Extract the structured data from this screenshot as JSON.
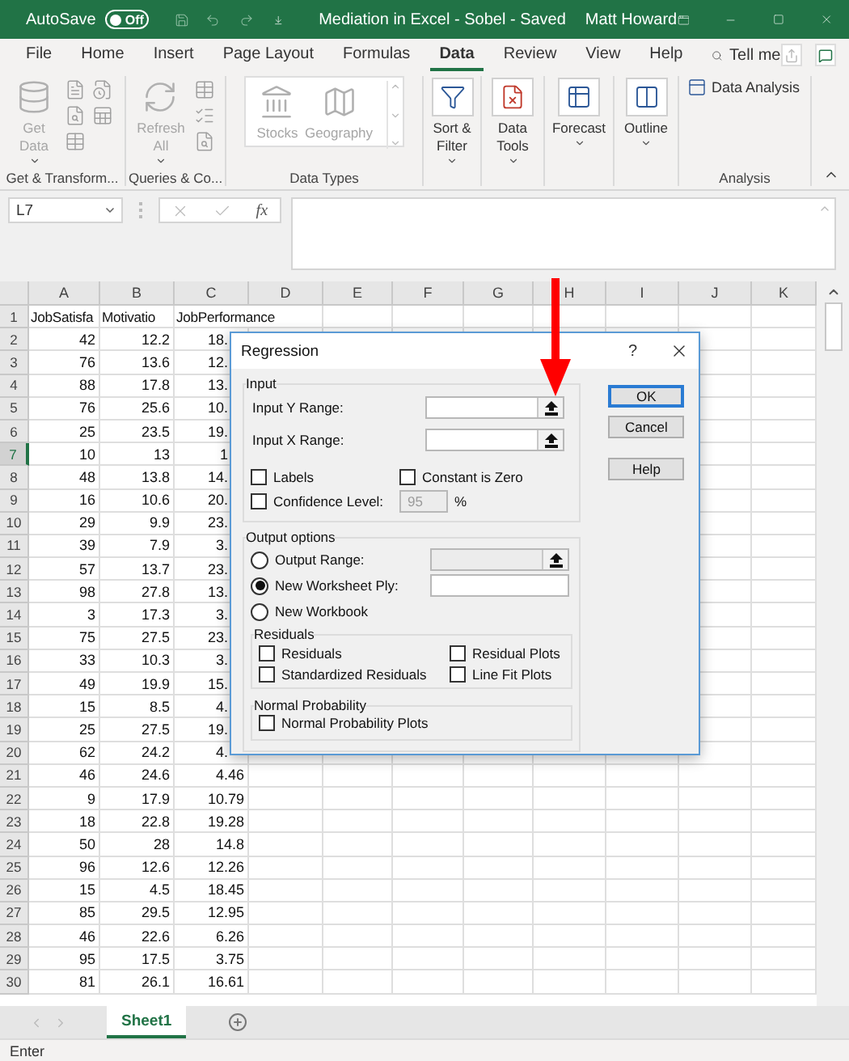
{
  "title_bar": {
    "autosave_label": "AutoSave",
    "autosave_toggle": {
      "text": "Off",
      "on": false
    },
    "title": "Mediation in Excel - Sobel  -  Saved",
    "user": "Matt Howard"
  },
  "menu_tabs": [
    {
      "label": "File",
      "selected": false
    },
    {
      "label": "Home",
      "selected": false
    },
    {
      "label": "Insert",
      "selected": false
    },
    {
      "label": "Page Layout",
      "selected": false
    },
    {
      "label": "Formulas",
      "selected": false
    },
    {
      "label": "Data",
      "selected": true
    },
    {
      "label": "Review",
      "selected": false
    },
    {
      "label": "View",
      "selected": false
    },
    {
      "label": "Help",
      "selected": false
    }
  ],
  "tell_me": "Tell me",
  "ribbon": {
    "groups": [
      {
        "kind": "get",
        "label": "Get & Transform...",
        "buttons": [
          {
            "lines": [
              "Get",
              "Data"
            ],
            "dropdown": true,
            "disabled": true
          }
        ]
      },
      {
        "kind": "queries",
        "label": "Queries & Co...",
        "buttons": [
          {
            "lines": [
              "Refresh",
              "All"
            ],
            "dropdown": true,
            "disabled": true
          }
        ]
      },
      {
        "kind": "gallery",
        "label": "Data Types",
        "buttons": [
          {
            "lines": [
              "Stocks"
            ],
            "dropdown": false,
            "disabled": true
          },
          {
            "lines": [
              "Geography"
            ],
            "dropdown": false,
            "disabled": true
          }
        ]
      },
      {
        "kind": "big",
        "buttons": [
          {
            "lines": [
              "Sort &",
              "Filter"
            ],
            "dropdown": true,
            "disabled": false
          }
        ]
      },
      {
        "kind": "big",
        "buttons": [
          {
            "lines": [
              "Data",
              "Tools"
            ],
            "dropdown": true,
            "disabled": false
          }
        ]
      },
      {
        "kind": "big",
        "buttons": [
          {
            "lines": [
              "Forecast"
            ],
            "dropdown": true,
            "disabled": false
          }
        ]
      },
      {
        "kind": "big",
        "buttons": [
          {
            "lines": [
              "Outline"
            ],
            "dropdown": true,
            "disabled": false
          }
        ]
      },
      {
        "kind": "analysis",
        "label": "Analysis",
        "buttons": [
          {
            "lines": [
              "Data Analysis"
            ],
            "dropdown": false,
            "disabled": false
          }
        ]
      }
    ]
  },
  "formula_bar": {
    "name_box": "L7",
    "function_button": "fx"
  },
  "columns": [
    "A",
    "B",
    "C",
    "D",
    "E",
    "F",
    "G",
    "H",
    "I",
    "J",
    "K"
  ],
  "rows": [
    {
      "number": "1",
      "kind": "text",
      "selected": false,
      "cells": [
        "JobSatisfa",
        "Motivatio",
        "JobPerformance"
      ]
    },
    {
      "number": "2",
      "kind": "number",
      "selected": false,
      "covered": true,
      "cells": [
        "42",
        "12.2",
        "18."
      ]
    },
    {
      "number": "3",
      "kind": "number",
      "selected": false,
      "covered": true,
      "cells": [
        "76",
        "13.6",
        "12."
      ]
    },
    {
      "number": "4",
      "kind": "number",
      "selected": false,
      "covered": true,
      "cells": [
        "88",
        "17.8",
        "13."
      ]
    },
    {
      "number": "5",
      "kind": "number",
      "selected": false,
      "covered": true,
      "cells": [
        "76",
        "25.6",
        "10."
      ]
    },
    {
      "number": "6",
      "kind": "number",
      "selected": false,
      "covered": true,
      "cells": [
        "25",
        "23.5",
        "19."
      ]
    },
    {
      "number": "7",
      "kind": "number",
      "selected": true,
      "covered": true,
      "cells": [
        "10",
        "13",
        "1"
      ]
    },
    {
      "number": "8",
      "kind": "number",
      "selected": false,
      "covered": true,
      "cells": [
        "48",
        "13.8",
        "14."
      ]
    },
    {
      "number": "9",
      "kind": "number",
      "selected": false,
      "covered": true,
      "cells": [
        "16",
        "10.6",
        "20."
      ]
    },
    {
      "number": "10",
      "kind": "number",
      "selected": false,
      "covered": true,
      "cells": [
        "29",
        "9.9",
        "23."
      ]
    },
    {
      "number": "11",
      "kind": "number",
      "selected": false,
      "covered": true,
      "cells": [
        "39",
        "7.9",
        "3."
      ]
    },
    {
      "number": "12",
      "kind": "number",
      "selected": false,
      "covered": true,
      "cells": [
        "57",
        "13.7",
        "23."
      ]
    },
    {
      "number": "13",
      "kind": "number",
      "selected": false,
      "covered": true,
      "cells": [
        "98",
        "27.8",
        "13."
      ]
    },
    {
      "number": "14",
      "kind": "number",
      "selected": false,
      "covered": true,
      "cells": [
        "3",
        "17.3",
        "3."
      ]
    },
    {
      "number": "15",
      "kind": "number",
      "selected": false,
      "covered": true,
      "cells": [
        "75",
        "27.5",
        "23."
      ]
    },
    {
      "number": "16",
      "kind": "number",
      "selected": false,
      "covered": true,
      "cells": [
        "33",
        "10.3",
        "3."
      ]
    },
    {
      "number": "17",
      "kind": "number",
      "selected": false,
      "covered": true,
      "cells": [
        "49",
        "19.9",
        "15."
      ]
    },
    {
      "number": "18",
      "kind": "number",
      "selected": false,
      "covered": true,
      "cells": [
        "15",
        "8.5",
        "4."
      ]
    },
    {
      "number": "19",
      "kind": "number",
      "selected": false,
      "covered": true,
      "cells": [
        "25",
        "27.5",
        "19."
      ]
    },
    {
      "number": "20",
      "kind": "number",
      "selected": false,
      "covered": true,
      "cells": [
        "62",
        "24.2",
        "4."
      ]
    },
    {
      "number": "21",
      "kind": "number",
      "selected": false,
      "covered": false,
      "cells": [
        "46",
        "24.6",
        "4.46"
      ]
    },
    {
      "number": "22",
      "kind": "number",
      "selected": false,
      "covered": false,
      "cells": [
        "9",
        "17.9",
        "10.79"
      ]
    },
    {
      "number": "23",
      "kind": "number",
      "selected": false,
      "covered": false,
      "cells": [
        "18",
        "22.8",
        "19.28"
      ]
    },
    {
      "number": "24",
      "kind": "number",
      "selected": false,
      "covered": false,
      "cells": [
        "50",
        "28",
        "14.8"
      ]
    },
    {
      "number": "25",
      "kind": "number",
      "selected": false,
      "covered": false,
      "cells": [
        "96",
        "12.6",
        "12.26"
      ]
    },
    {
      "number": "26",
      "kind": "number",
      "selected": false,
      "covered": false,
      "cells": [
        "15",
        "4.5",
        "18.45"
      ]
    },
    {
      "number": "27",
      "kind": "number",
      "selected": false,
      "covered": false,
      "cells": [
        "85",
        "29.5",
        "12.95"
      ]
    },
    {
      "number": "28",
      "kind": "number",
      "selected": false,
      "covered": false,
      "cells": [
        "46",
        "22.6",
        "6.26"
      ]
    },
    {
      "number": "29",
      "kind": "number",
      "selected": false,
      "covered": false,
      "cells": [
        "95",
        "17.5",
        "3.75"
      ]
    },
    {
      "number": "30",
      "kind": "number",
      "selected": false,
      "covered": false,
      "cells": [
        "81",
        "26.1",
        "16.61"
      ]
    }
  ],
  "sheet_tabs": [
    {
      "label": "Sheet1",
      "selected": true
    }
  ],
  "status_bar": {
    "mode": "Enter"
  },
  "dialog": {
    "title": "Regression",
    "help_button": "?",
    "input_group": {
      "legend": "Input",
      "ranges": [
        {
          "label": "Input Y Range:"
        },
        {
          "label": "Input X Range:"
        }
      ],
      "checkboxes": [
        {
          "label": "Labels",
          "checked": false
        },
        {
          "label": "Constant is Zero",
          "checked": false
        },
        {
          "label": "Confidence Level:",
          "checked": false
        }
      ],
      "confidence": {
        "value": "95",
        "disabled": true,
        "unit": "%"
      }
    },
    "output_group": {
      "legend": "Output options",
      "options": [
        {
          "label": "Output Range:",
          "selected": false,
          "field": {
            "disabled": true,
            "ref_button": true
          }
        },
        {
          "label": "New Worksheet Ply:",
          "selected": true,
          "field": {
            "disabled": false,
            "ref_button": false
          }
        },
        {
          "label": "New Workbook",
          "selected": false
        }
      ],
      "residuals": {
        "legend": "Residuals",
        "checkboxes": [
          {
            "label": "Residuals",
            "checked": false
          },
          {
            "label": "Residual Plots",
            "checked": false
          },
          {
            "label": "Standardized Residuals",
            "checked": false
          },
          {
            "label": "Line Fit Plots",
            "checked": false
          }
        ]
      },
      "normal": {
        "legend": "Normal Probability",
        "checkboxes": [
          {
            "label": "Normal Probability Plots",
            "checked": false
          }
        ]
      }
    },
    "buttons": [
      {
        "label": "OK",
        "default": true
      },
      {
        "label": "Cancel",
        "default": false
      },
      {
        "label": "Help",
        "default": false
      }
    ]
  }
}
